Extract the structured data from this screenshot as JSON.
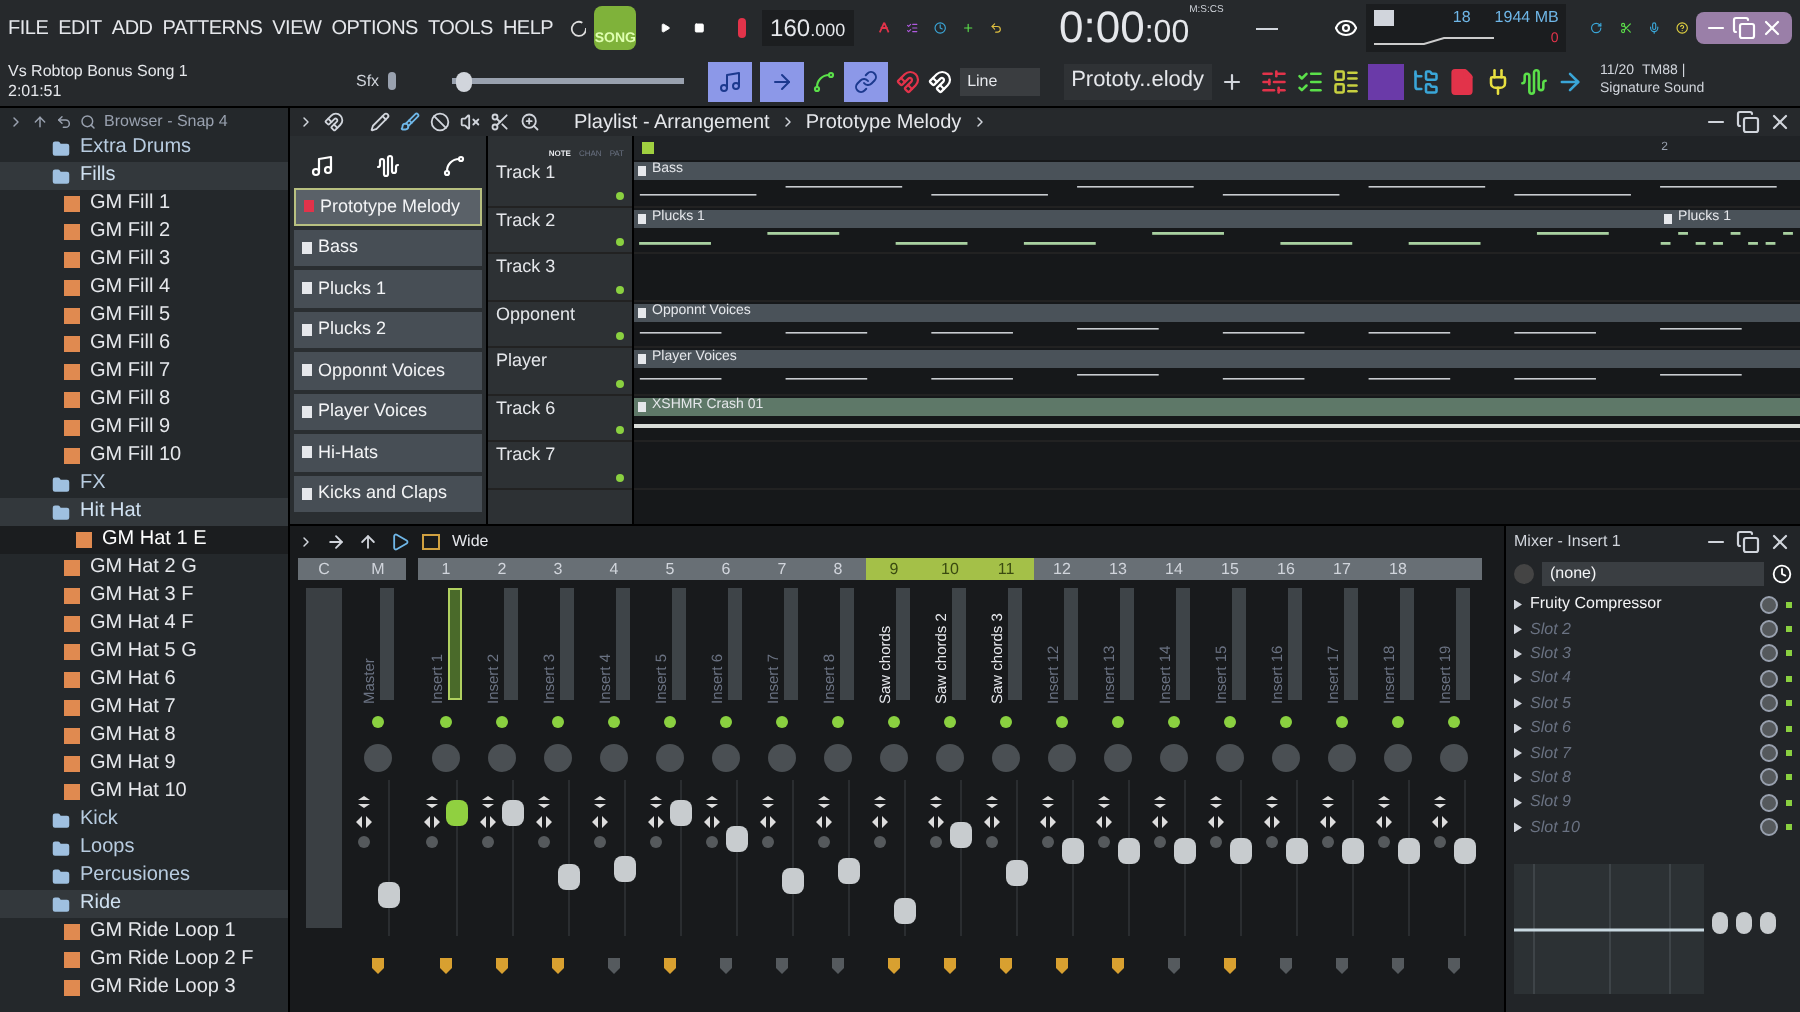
{
  "menu": [
    "FILE",
    "EDIT",
    "ADD",
    "PATTERNS",
    "VIEW",
    "OPTIONS",
    "TOOLS",
    "HELP"
  ],
  "transport": {
    "mode_label": "SONG",
    "song_mode": true,
    "tempo": "160",
    "tempo_fraction": ".000"
  },
  "time": {
    "value": "0:00",
    "centiseconds": ":00",
    "unit": "M:S:CS"
  },
  "monitor": {
    "cpu": "18",
    "memory": "1944 MB",
    "polyphony": "0"
  },
  "project": {
    "title": "Vs Robtop Bonus Song 1",
    "length": "2:01:51",
    "sfx_label": "Sfx"
  },
  "master_pitch": {
    "level": 0.02
  },
  "snap": "Line",
  "pattern_selector": "Prototy..elody",
  "news": {
    "date": "11/20",
    "title": "TM88 |",
    "subtitle": "Signature Sound"
  },
  "browser": {
    "title": "Browser - Snap 4",
    "items": [
      {
        "label": "Extra Drums",
        "kind": "folder",
        "expanded": false
      },
      {
        "label": "Fills",
        "kind": "folder",
        "expanded": true,
        "children": [
          {
            "label": "GM Fill 1",
            "kind": "file",
            "selected": false
          },
          {
            "label": "GM Fill 2",
            "kind": "file",
            "selected": false
          },
          {
            "label": "GM Fill 3",
            "kind": "file",
            "selected": false
          },
          {
            "label": "GM Fill 4",
            "kind": "file",
            "selected": false
          },
          {
            "label": "GM Fill 5",
            "kind": "file",
            "selected": false
          },
          {
            "label": "GM Fill 6",
            "kind": "file",
            "selected": false
          },
          {
            "label": "GM Fill 7",
            "kind": "file",
            "selected": false
          },
          {
            "label": "GM Fill 8",
            "kind": "file",
            "selected": false
          },
          {
            "label": "GM Fill 9",
            "kind": "file",
            "selected": false
          },
          {
            "label": "GM Fill 10",
            "kind": "file",
            "selected": false
          }
        ]
      },
      {
        "label": "FX",
        "kind": "folder",
        "expanded": false
      },
      {
        "label": "Hit Hat",
        "kind": "folder",
        "expanded": true,
        "children": [
          {
            "label": "GM Hat 1  E",
            "kind": "file",
            "selected": true
          },
          {
            "label": "GM Hat 2 G",
            "kind": "file",
            "selected": false
          },
          {
            "label": "GM Hat 3  F",
            "kind": "file",
            "selected": false
          },
          {
            "label": "GM Hat 4  F",
            "kind": "file",
            "selected": false
          },
          {
            "label": "GM Hat 5 G",
            "kind": "file",
            "selected": false
          },
          {
            "label": "GM Hat 6",
            "kind": "file",
            "selected": false
          },
          {
            "label": "GM Hat 7",
            "kind": "file",
            "selected": false
          },
          {
            "label": "GM Hat 8",
            "kind": "file",
            "selected": false
          },
          {
            "label": "GM Hat 9",
            "kind": "file",
            "selected": false
          },
          {
            "label": "GM Hat 10",
            "kind": "file",
            "selected": false
          }
        ]
      },
      {
        "label": "Kick",
        "kind": "folder",
        "expanded": false
      },
      {
        "label": "Loops",
        "kind": "folder",
        "expanded": false
      },
      {
        "label": "Percusiones",
        "kind": "folder",
        "expanded": false
      },
      {
        "label": "Ride",
        "kind": "folder",
        "expanded": true,
        "children": [
          {
            "label": "GM Ride Loop 1",
            "kind": "file",
            "selected": false
          },
          {
            "label": "Gm Ride Loop 2 F",
            "kind": "file",
            "selected": false
          },
          {
            "label": "GM Ride Loop 3",
            "kind": "file",
            "selected": false
          }
        ]
      }
    ]
  },
  "playlist": {
    "title": "Playlist - Arrangement",
    "pattern": "Prototype Melody",
    "bar_marker": "2",
    "modes": [
      {
        "label": "NOTE",
        "selected": true
      },
      {
        "label": "CHAN",
        "selected": false
      },
      {
        "label": "PAT",
        "selected": false
      }
    ],
    "patterns": [
      {
        "label": "Prototype Melody",
        "selected": true
      },
      {
        "label": "Bass",
        "selected": false
      },
      {
        "label": "Plucks 1",
        "selected": false
      },
      {
        "label": "Plucks 2",
        "selected": false
      },
      {
        "label": "Opponnt Voices",
        "selected": false
      },
      {
        "label": "Player Voices",
        "selected": false
      },
      {
        "label": "Hi-Hats",
        "selected": false
      },
      {
        "label": "Kicks and Claps",
        "selected": false
      }
    ],
    "tracks": [
      {
        "name": "Track 1",
        "clips": [
          {
            "label": "Bass",
            "kind": "pattern"
          }
        ]
      },
      {
        "name": "Track 2",
        "clips": [
          {
            "label": "Plucks 1",
            "kind": "pattern"
          },
          {
            "label": "Plucks 1",
            "kind": "pattern"
          }
        ]
      },
      {
        "name": "Track 3"
      },
      {
        "name": "Opponent",
        "clips": [
          {
            "label": "Opponnt Voices",
            "kind": "pattern"
          }
        ]
      },
      {
        "name": "Player",
        "clips": [
          {
            "label": "Player Voices",
            "kind": "pattern"
          }
        ]
      },
      {
        "name": "Track 6",
        "clips": [
          {
            "label": "XSHMR Crash 01",
            "kind": "audio"
          }
        ]
      },
      {
        "name": "Track 7"
      }
    ]
  },
  "mixer": {
    "stereo_mode": "Wide",
    "current_label": "C",
    "strips": [
      {
        "number": "M",
        "name": "Master",
        "selected": false,
        "highlighted": false,
        "level": 0.21,
        "armed": true
      },
      {
        "number": "1",
        "name": "Insert 1",
        "selected": true,
        "highlighted": false,
        "level": 0.84,
        "armed": true
      },
      {
        "number": "2",
        "name": "Insert 2",
        "selected": false,
        "highlighted": false,
        "level": 0.85,
        "armed": true
      },
      {
        "number": "3",
        "name": "Insert 3",
        "selected": false,
        "highlighted": false,
        "level": 0.35,
        "armed": true
      },
      {
        "number": "4",
        "name": "Insert 4",
        "selected": false,
        "highlighted": false,
        "level": 0.42,
        "armed": false
      },
      {
        "number": "5",
        "name": "Insert 5",
        "selected": false,
        "highlighted": false,
        "level": 0.85,
        "armed": true
      },
      {
        "number": "6",
        "name": "Insert 6",
        "selected": false,
        "highlighted": false,
        "level": 0.65,
        "armed": false
      },
      {
        "number": "7",
        "name": "Insert 7",
        "selected": false,
        "highlighted": false,
        "level": 0.33,
        "armed": false
      },
      {
        "number": "8",
        "name": "Insert 8",
        "selected": false,
        "highlighted": false,
        "level": 0.4,
        "armed": false
      },
      {
        "number": "9",
        "name": "Saw chords",
        "selected": false,
        "highlighted": true,
        "level": 0.1,
        "armed": true
      },
      {
        "number": "10",
        "name": "Saw chords 2",
        "selected": false,
        "highlighted": true,
        "level": 0.68,
        "armed": true
      },
      {
        "number": "11",
        "name": "Saw chords 3",
        "selected": false,
        "highlighted": true,
        "level": 0.38,
        "armed": true
      },
      {
        "number": "12",
        "name": "Insert 12",
        "selected": false,
        "highlighted": false,
        "level": 0.55,
        "armed": true
      },
      {
        "number": "13",
        "name": "Insert 13",
        "selected": false,
        "highlighted": false,
        "level": 0.56,
        "armed": true
      },
      {
        "number": "14",
        "name": "Insert 14",
        "selected": false,
        "highlighted": false,
        "level": 0.56,
        "armed": false
      },
      {
        "number": "15",
        "name": "Insert 15",
        "selected": false,
        "highlighted": false,
        "level": 0.55,
        "armed": true
      },
      {
        "number": "16",
        "name": "Insert 16",
        "selected": false,
        "highlighted": false,
        "level": 0.56,
        "armed": false
      },
      {
        "number": "17",
        "name": "Insert 17",
        "selected": false,
        "highlighted": false,
        "level": 0.56,
        "armed": false
      },
      {
        "number": "18",
        "name": "Insert 18",
        "selected": false,
        "highlighted": false,
        "level": 0.56,
        "armed": false
      },
      {
        "name": "Insert 19",
        "selected": false,
        "highlighted": false,
        "level": 0.56,
        "armed": false
      }
    ]
  },
  "insert_panel": {
    "title": "Mixer - Insert 1",
    "preset": "(none)",
    "slots": [
      {
        "name": "Fruity Compressor",
        "filled": true
      },
      {
        "name": "Slot 2",
        "filled": false
      },
      {
        "name": "Slot 3",
        "filled": false
      },
      {
        "name": "Slot 4",
        "filled": false
      },
      {
        "name": "Slot 5",
        "filled": false
      },
      {
        "name": "Slot 6",
        "filled": false
      },
      {
        "name": "Slot 7",
        "filled": false
      },
      {
        "name": "Slot 8",
        "filled": false
      },
      {
        "name": "Slot 9",
        "filled": false
      },
      {
        "name": "Slot 10",
        "filled": false
      }
    ]
  }
}
